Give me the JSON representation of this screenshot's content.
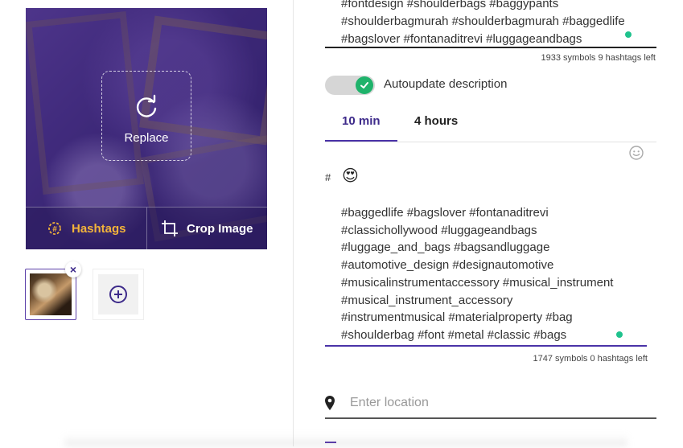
{
  "image_card": {
    "replace_label": "Replace",
    "hashtags_label": "Hashtags",
    "crop_label": "Crop Image",
    "icons": [
      "replace-icon",
      "hashtags-icon",
      "crop-icon"
    ]
  },
  "thumbnails": {
    "close_symbol": "×",
    "add_icon": "plus-circle-icon"
  },
  "description": {
    "lines": [
      "#fontdesign #shoulderbags #baggypants",
      "#shoulderbagmurah #shoulderbagmurah #baggedlife",
      "#bagslover #fontanaditrevi #luggageandbags"
    ],
    "counter": "1933 symbols 9 hashtags left"
  },
  "autoupdate": {
    "label": "Autoupdate description",
    "enabled": true
  },
  "tabs": [
    {
      "label": "10 min",
      "active": true
    },
    {
      "label": "4 hours",
      "active": false
    }
  ],
  "post": {
    "hash_symbol": "#",
    "emoji": "😍",
    "lines": [
      "#baggedlife #bagslover #fontanaditrevi",
      "#classichollywood #luggageandbags",
      "#luggage_and_bags #bagsandluggage",
      "#automotive_design #designautomotive",
      "#musicalinstrumentaccessory #musical_instrument",
      "#musical_instrument_accessory",
      "#instrumentmusical #materialproperty #bag",
      "#shoulderbag #font #metal #classic #bags"
    ],
    "counter": "1747 symbols 0 hashtags left"
  },
  "location": {
    "placeholder": "Enter location",
    "value": ""
  },
  "colors": {
    "accent": "#3d2a8a",
    "hashtags_orange": "#f3b43a",
    "status_green": "#1fc28d",
    "toggle_green": "#1fb36b"
  }
}
